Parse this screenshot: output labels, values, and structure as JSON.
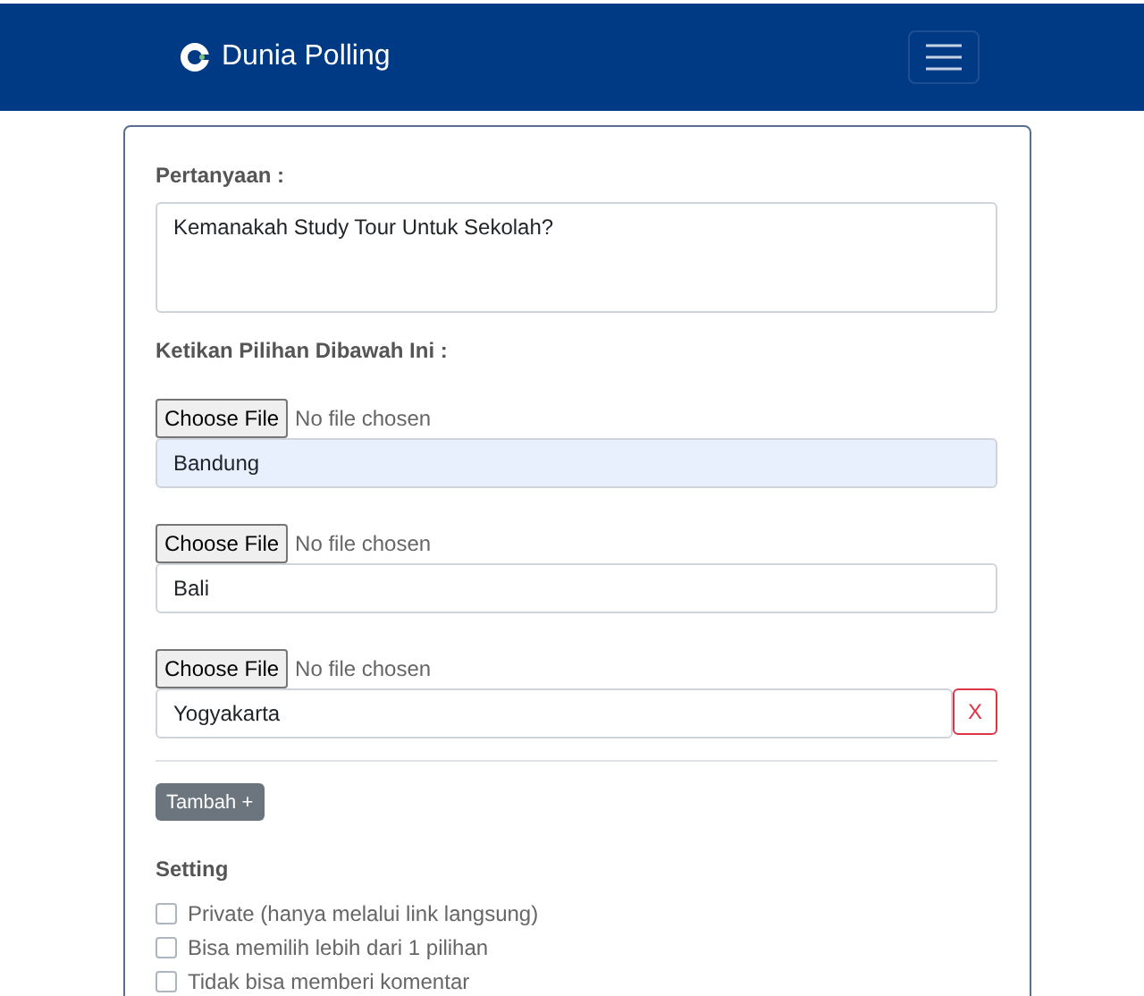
{
  "navbar": {
    "brand": "Dunia Polling"
  },
  "question": {
    "label": "Pertanyaan :",
    "value": "Kemanakah Study Tour Untuk Sekolah?"
  },
  "options_label": "Ketikan Pilihan Dibawah Ini :",
  "options": [
    {
      "file_button": "Choose File",
      "file_status": "No file chosen",
      "value": "Bandung",
      "autofilled": true
    },
    {
      "file_button": "Choose File",
      "file_status": "No file chosen",
      "value": "Bali",
      "autofilled": false
    },
    {
      "file_button": "Choose File",
      "file_status": "No file chosen",
      "value": "Yogyakarta",
      "autofilled": false,
      "remove_label": "X"
    }
  ],
  "add_button": "Tambah +",
  "settings": {
    "title": "Setting",
    "items": [
      {
        "label": "Private (hanya melalui link langsung)",
        "checked": false
      },
      {
        "label": "Bisa memilih lebih dari 1 pilihan",
        "checked": false
      },
      {
        "label": "Tidak bisa memberi komentar",
        "checked": false
      }
    ]
  }
}
